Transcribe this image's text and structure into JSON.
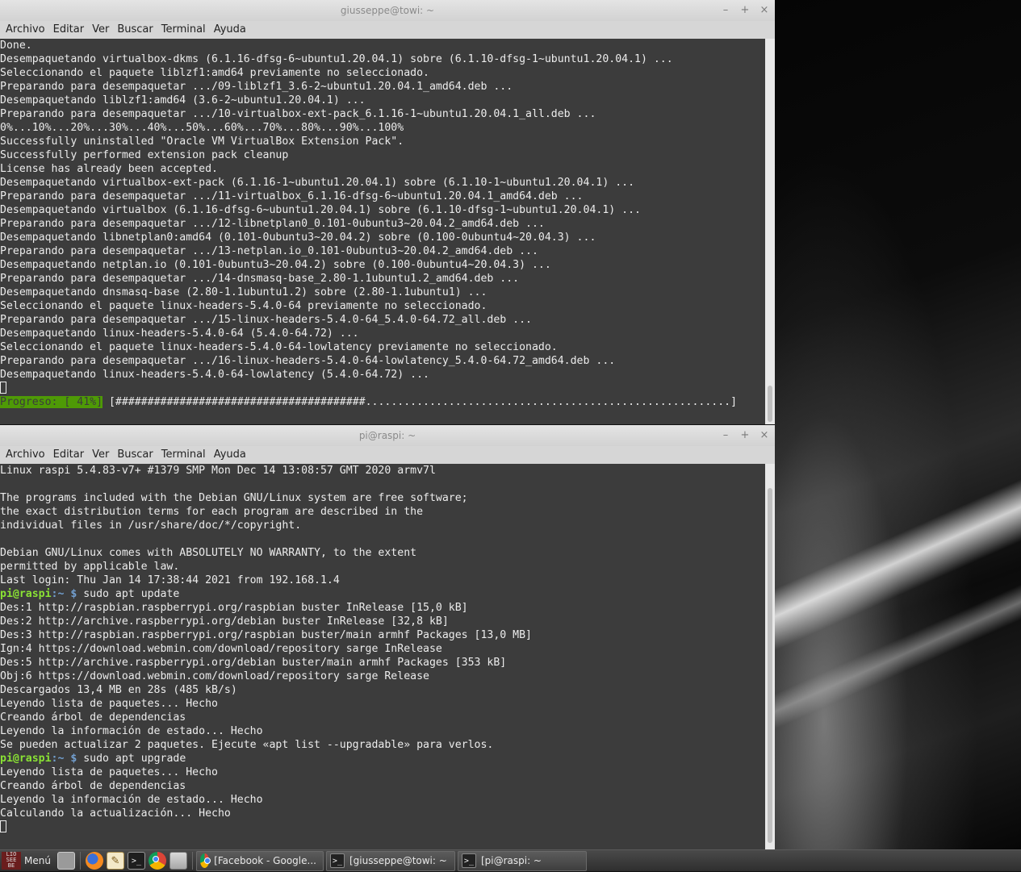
{
  "top_window": {
    "title": "giusseppe@towi: ~",
    "menu": [
      "Archivo",
      "Editar",
      "Ver",
      "Buscar",
      "Terminal",
      "Ayuda"
    ],
    "controls": {
      "minimize": "–",
      "maximize": "+",
      "close": "×"
    },
    "lines": [
      "Done.",
      "Desempaquetando virtualbox-dkms (6.1.16-dfsg-6~ubuntu1.20.04.1) sobre (6.1.10-dfsg-1~ubuntu1.20.04.1) ...",
      "Seleccionando el paquete liblzf1:amd64 previamente no seleccionado.",
      "Preparando para desempaquetar .../09-liblzf1_3.6-2~ubuntu1.20.04.1_amd64.deb ...",
      "Desempaquetando liblzf1:amd64 (3.6-2~ubuntu1.20.04.1) ...",
      "Preparando para desempaquetar .../10-virtualbox-ext-pack_6.1.16-1~ubuntu1.20.04.1_all.deb ...",
      "0%...10%...20%...30%...40%...50%...60%...70%...80%...90%...100%",
      "Successfully uninstalled \"Oracle VM VirtualBox Extension Pack\".",
      "Successfully performed extension pack cleanup",
      "License has already been accepted.",
      "Desempaquetando virtualbox-ext-pack (6.1.16-1~ubuntu1.20.04.1) sobre (6.1.10-1~ubuntu1.20.04.1) ...",
      "Preparando para desempaquetar .../11-virtualbox_6.1.16-dfsg-6~ubuntu1.20.04.1_amd64.deb ...",
      "Desempaquetando virtualbox (6.1.16-dfsg-6~ubuntu1.20.04.1) sobre (6.1.10-dfsg-1~ubuntu1.20.04.1) ...",
      "Preparando para desempaquetar .../12-libnetplan0_0.101-0ubuntu3~20.04.2_amd64.deb ...",
      "Desempaquetando libnetplan0:amd64 (0.101-0ubuntu3~20.04.2) sobre (0.100-0ubuntu4~20.04.3) ...",
      "Preparando para desempaquetar .../13-netplan.io_0.101-0ubuntu3~20.04.2_amd64.deb ...",
      "Desempaquetando netplan.io (0.101-0ubuntu3~20.04.2) sobre (0.100-0ubuntu4~20.04.3) ...",
      "Preparando para desempaquetar .../14-dnsmasq-base_2.80-1.1ubuntu1.2_amd64.deb ...",
      "Desempaquetando dnsmasq-base (2.80-1.1ubuntu1.2) sobre (2.80-1.1ubuntu1) ...",
      "Seleccionando el paquete linux-headers-5.4.0-64 previamente no seleccionado.",
      "Preparando para desempaquetar .../15-linux-headers-5.4.0-64_5.4.0-64.72_all.deb ...",
      "Desempaquetando linux-headers-5.4.0-64 (5.4.0-64.72) ...",
      "Seleccionando el paquete linux-headers-5.4.0-64-lowlatency previamente no seleccionado.",
      "Preparando para desempaquetar .../16-linux-headers-5.4.0-64-lowlatency_5.4.0-64.72_amd64.deb ...",
      "Desempaquetando linux-headers-5.4.0-64-lowlatency (5.4.0-64.72) ..."
    ],
    "progress_label": "Progreso: [ 41%]",
    "progress_bar": " [#######################################.........................................................]"
  },
  "bottom_window": {
    "title": "pi@raspi: ~",
    "menu": [
      "Archivo",
      "Editar",
      "Ver",
      "Buscar",
      "Terminal",
      "Ayuda"
    ],
    "controls": {
      "minimize": "–",
      "maximize": "+",
      "close": "×"
    },
    "prompt_user": "pi@raspi",
    "prompt_path": ":~ $ ",
    "lines": [
      {
        "text": "Linux raspi 5.4.83-v7+ #1379 SMP Mon Dec 14 13:08:57 GMT 2020 armv7l"
      },
      {
        "text": ""
      },
      {
        "text": "The programs included with the Debian GNU/Linux system are free software;"
      },
      {
        "text": "the exact distribution terms for each program are described in the"
      },
      {
        "text": "individual files in /usr/share/doc/*/copyright."
      },
      {
        "text": ""
      },
      {
        "text": "Debian GNU/Linux comes with ABSOLUTELY NO WARRANTY, to the extent"
      },
      {
        "text": "permitted by applicable law."
      },
      {
        "text": "Last login: Thu Jan 14 17:38:44 2021 from 192.168.1.4"
      },
      {
        "prompt": true,
        "text": "sudo apt update"
      },
      {
        "text": "Des:1 http://raspbian.raspberrypi.org/raspbian buster InRelease [15,0 kB]"
      },
      {
        "text": "Des:2 http://archive.raspberrypi.org/debian buster InRelease [32,8 kB]"
      },
      {
        "text": "Des:3 http://raspbian.raspberrypi.org/raspbian buster/main armhf Packages [13,0 MB]"
      },
      {
        "text": "Ign:4 https://download.webmin.com/download/repository sarge InRelease"
      },
      {
        "text": "Des:5 http://archive.raspberrypi.org/debian buster/main armhf Packages [353 kB]"
      },
      {
        "text": "Obj:6 https://download.webmin.com/download/repository sarge Release"
      },
      {
        "text": "Descargados 13,4 MB en 28s (485 kB/s)"
      },
      {
        "text": "Leyendo lista de paquetes... Hecho"
      },
      {
        "text": "Creando árbol de dependencias"
      },
      {
        "text": "Leyendo la información de estado... Hecho"
      },
      {
        "text": "Se pueden actualizar 2 paquetes. Ejecute «apt list --upgradable» para verlos."
      },
      {
        "prompt": true,
        "text": "sudo apt upgrade"
      },
      {
        "text": "Leyendo lista de paquetes... Hecho"
      },
      {
        "text": "Creando árbol de dependencias"
      },
      {
        "text": "Leyendo la información de estado... Hecho"
      },
      {
        "text": "Calculando la actualización... Hecho"
      }
    ]
  },
  "taskbar": {
    "menu_label": "Menú",
    "menu_logo_text": "LIO\nSEE\nBE",
    "launchers": [
      "show-desktop-icon",
      "firefox-icon",
      "text-editor-icon",
      "terminal-icon",
      "chrome-icon",
      "file-manager-icon"
    ],
    "tasks": [
      {
        "label": "[Facebook - Google...",
        "icon": "chrome-icon"
      },
      {
        "label": "[giusseppe@towi: ~",
        "icon": "terminal-icon"
      },
      {
        "label": "[pi@raspi: ~",
        "icon": "terminal-icon"
      }
    ]
  }
}
